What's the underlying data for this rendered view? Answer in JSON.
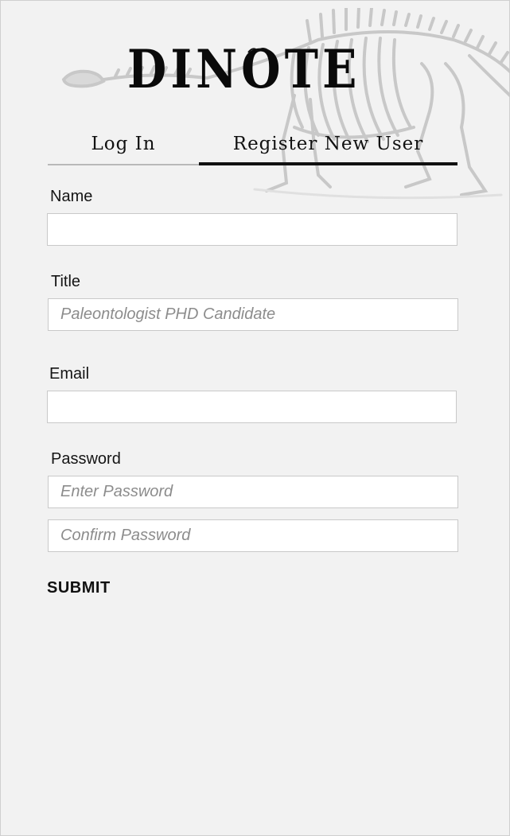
{
  "app": {
    "logo_text": "DINOTE"
  },
  "tabs": [
    {
      "label": "Log In",
      "active": false
    },
    {
      "label": "Register New User",
      "active": true
    }
  ],
  "form": {
    "name": {
      "label": "Name",
      "value": "",
      "placeholder": ""
    },
    "title": {
      "label": "Title",
      "value": "",
      "placeholder": "Paleontologist PHD Candidate"
    },
    "email": {
      "label": "Email",
      "value": "",
      "placeholder": ""
    },
    "password": {
      "label": "Password",
      "placeholder": "Enter Password",
      "confirm_placeholder": "Confirm Password"
    },
    "submit_label": "SUBMIT"
  },
  "colors": {
    "background": "#f2f2f2",
    "text": "#111111",
    "placeholder": "#8c8c8c",
    "skeleton": "#c8c8c8",
    "tab_active_underline": "#111111",
    "tab_inactive_underline": "#b9b9b9"
  },
  "icons": [
    "dinosaur-skeleton-illustration"
  ]
}
